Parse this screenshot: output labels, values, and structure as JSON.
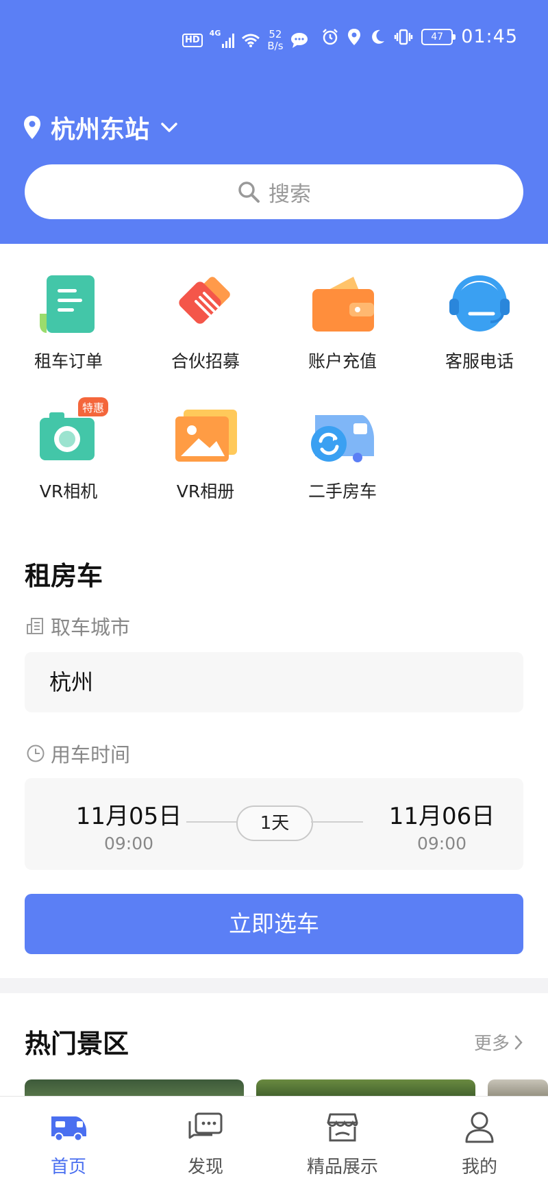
{
  "status_bar": {
    "network_badge": "HD",
    "network_type": "4G",
    "speed_value": "52",
    "speed_unit": "B/s",
    "battery": "47",
    "time": "01:45"
  },
  "location": {
    "label": "杭州东站"
  },
  "search": {
    "placeholder": "搜索"
  },
  "quick_actions": [
    {
      "label": "租车订单",
      "icon": "order-icon"
    },
    {
      "label": "合伙招募",
      "icon": "handshake-icon"
    },
    {
      "label": "账户充值",
      "icon": "wallet-icon"
    },
    {
      "label": "客服电话",
      "icon": "headset-icon"
    },
    {
      "label": "VR相机",
      "icon": "camera-icon",
      "badge": "特惠"
    },
    {
      "label": "VR相册",
      "icon": "album-icon"
    },
    {
      "label": "二手房车",
      "icon": "used-rv-icon"
    }
  ],
  "rent": {
    "title": "租房车",
    "city_label": "取车城市",
    "city_value": "杭州",
    "time_label": "用车时间",
    "start_date": "11月05日",
    "start_time": "09:00",
    "duration": "1天",
    "end_date": "11月06日",
    "end_time": "09:00",
    "cta": "立即选车"
  },
  "hot": {
    "title": "热门景区",
    "more": "更多"
  },
  "tabs": [
    {
      "label": "首页",
      "icon": "rv-icon",
      "active": true
    },
    {
      "label": "发现",
      "icon": "chat-icon",
      "active": false
    },
    {
      "label": "精品展示",
      "icon": "store-icon",
      "active": false
    },
    {
      "label": "我的",
      "icon": "user-icon",
      "active": false
    }
  ],
  "colors": {
    "primary": "#5b7ff5",
    "active_tab": "#4a6ff0",
    "badge": "#f4663b"
  }
}
